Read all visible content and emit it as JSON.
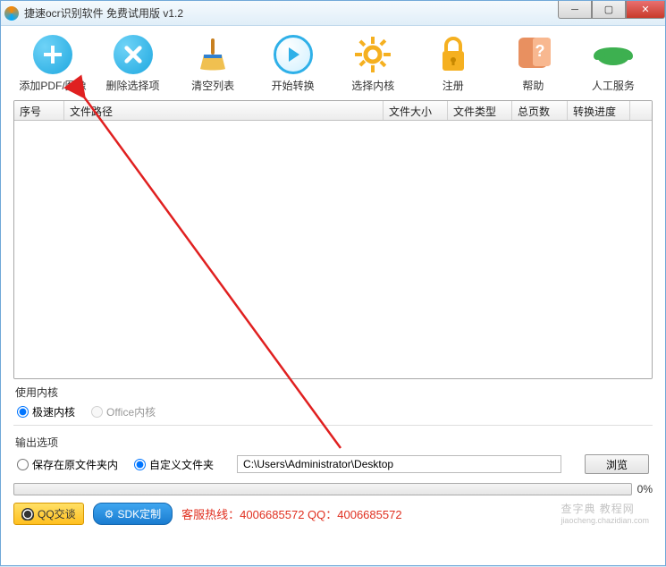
{
  "window": {
    "title": "捷速ocr识别软件 免费试用版 v1.2"
  },
  "toolbar": {
    "add": "添加PDF/图像",
    "del": "删除选择项",
    "clear": "清空列表",
    "start": "开始转换",
    "engine": "选择内核",
    "register": "注册",
    "help": "帮助",
    "service": "人工服务"
  },
  "table": {
    "headers": {
      "seq": "序号",
      "path": "文件路径",
      "size": "文件大小",
      "type": "文件类型",
      "pages": "总页数",
      "progress": "转换进度"
    }
  },
  "engine_section": {
    "label": "使用内核",
    "fast": "极速内核",
    "office": "Office内核"
  },
  "output_section": {
    "label": "输出选项",
    "save_original": "保存在原文件夹内",
    "custom_folder": "自定义文件夹",
    "path_value": "C:\\Users\\Administrator\\Desktop",
    "browse": "浏览"
  },
  "progress": {
    "text": "0%"
  },
  "footer": {
    "qq": "QQ交谈",
    "sdk": "SDK定制",
    "hotline": "客服热线：4006685572 QQ：4006685572",
    "watermark_main": "查字典 教程网",
    "watermark_sub": "jiaocheng.chazidian.com"
  }
}
